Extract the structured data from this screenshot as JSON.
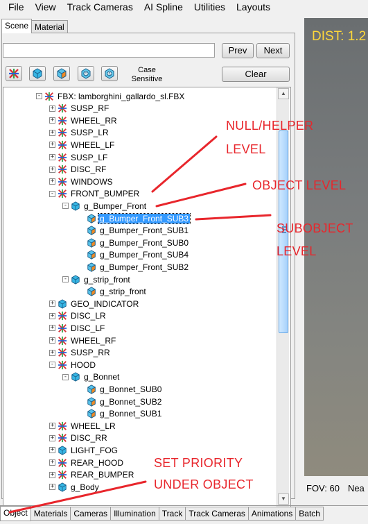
{
  "menu": [
    "File",
    "View",
    "Track Cameras",
    "AI Spline",
    "Utilities",
    "Layouts"
  ],
  "top_tabs": {
    "scene": "Scene",
    "material": "Material"
  },
  "search": {
    "value": "",
    "placeholder": ""
  },
  "buttons": {
    "prev": "Prev",
    "next": "Next",
    "clear": "Clear",
    "case_sensitive": "Case\nSensitive"
  },
  "filter_icons": [
    "helper-filter-icon",
    "object-filter-icon",
    "subobject-filter-icon",
    "material-filter-icon",
    "texture-filter-icon"
  ],
  "tree": [
    {
      "label": "FBX: lamborghini_gallardo_sl.FBX",
      "icon": "helper",
      "expander": "-",
      "level": 0
    },
    {
      "label": "SUSP_RF",
      "icon": "helper",
      "expander": "+",
      "level": 1
    },
    {
      "label": "WHEEL_RR",
      "icon": "helper",
      "expander": "+",
      "level": 1
    },
    {
      "label": "SUSP_LR",
      "icon": "helper",
      "expander": "+",
      "level": 1
    },
    {
      "label": "WHEEL_LF",
      "icon": "helper",
      "expander": "+",
      "level": 1
    },
    {
      "label": "SUSP_LF",
      "icon": "helper",
      "expander": "+",
      "level": 1
    },
    {
      "label": "DISC_RF",
      "icon": "helper",
      "expander": "+",
      "level": 1
    },
    {
      "label": "WINDOWS",
      "icon": "helper",
      "expander": "+",
      "level": 1
    },
    {
      "label": "FRONT_BUMPER",
      "icon": "helper",
      "expander": "-",
      "level": 1
    },
    {
      "label": "g_Bumper_Front",
      "icon": "object",
      "expander": "-",
      "level": 2
    },
    {
      "label": "g_Bumper_Front_SUB3",
      "icon": "sub",
      "expander": "",
      "level": 3,
      "selected": true
    },
    {
      "label": "g_Bumper_Front_SUB1",
      "icon": "sub",
      "expander": "",
      "level": 3
    },
    {
      "label": "g_Bumper_Front_SUB0",
      "icon": "sub",
      "expander": "",
      "level": 3
    },
    {
      "label": "g_Bumper_Front_SUB4",
      "icon": "sub",
      "expander": "",
      "level": 3
    },
    {
      "label": "g_Bumper_Front_SUB2",
      "icon": "sub",
      "expander": "",
      "level": 3
    },
    {
      "label": "g_strip_front",
      "icon": "object",
      "expander": "-",
      "level": 2
    },
    {
      "label": "g_strip_front",
      "icon": "sub",
      "expander": "",
      "level": 3
    },
    {
      "label": "GEO_INDICATOR",
      "icon": "object",
      "expander": "+",
      "level": 1
    },
    {
      "label": "DISC_LR",
      "icon": "helper",
      "expander": "+",
      "level": 1
    },
    {
      "label": "DISC_LF",
      "icon": "helper",
      "expander": "+",
      "level": 1
    },
    {
      "label": "WHEEL_RF",
      "icon": "helper",
      "expander": "+",
      "level": 1
    },
    {
      "label": "SUSP_RR",
      "icon": "helper",
      "expander": "+",
      "level": 1
    },
    {
      "label": "HOOD",
      "icon": "helper",
      "expander": "-",
      "level": 1
    },
    {
      "label": "g_Bonnet",
      "icon": "object",
      "expander": "-",
      "level": 2
    },
    {
      "label": "g_Bonnet_SUB0",
      "icon": "sub",
      "expander": "",
      "level": 3
    },
    {
      "label": "g_Bonnet_SUB2",
      "icon": "sub",
      "expander": "",
      "level": 3
    },
    {
      "label": "g_Bonnet_SUB1",
      "icon": "sub",
      "expander": "",
      "level": 3
    },
    {
      "label": "WHEEL_LR",
      "icon": "helper",
      "expander": "+",
      "level": 1
    },
    {
      "label": "DISC_RR",
      "icon": "helper",
      "expander": "+",
      "level": 1
    },
    {
      "label": "LIGHT_FOG",
      "icon": "object",
      "expander": "+",
      "level": 1
    },
    {
      "label": "REAR_HOOD",
      "icon": "helper",
      "expander": "+",
      "level": 1
    },
    {
      "label": "REAR_BUMPER",
      "icon": "helper",
      "expander": "+",
      "level": 1
    },
    {
      "label": "g_Body",
      "icon": "object",
      "expander": "+",
      "level": 1
    }
  ],
  "viewport": {
    "dist": "DIST: 1.2",
    "fov": "FOV: 60",
    "near": "Nea"
  },
  "bottom_tabs": [
    "Object",
    "Materials",
    "Cameras",
    "Illumination",
    "Track",
    "Track Cameras",
    "Animations",
    "Batch"
  ],
  "annotations": {
    "null_helper": "NULL/HELPER",
    "null_helper_2": "LEVEL",
    "object_level": "OBJECT LEVEL",
    "subobject": "SUBOBJECT",
    "subobject_2": "LEVEL",
    "set_priority": "SET PRIORITY",
    "under_object": "UNDER OBJECT",
    "color": "#e8262c"
  },
  "colors": {
    "selection": "#3399ff",
    "dist_text": "#ffd83a",
    "scroll_thumb": "#a7d1fb"
  }
}
